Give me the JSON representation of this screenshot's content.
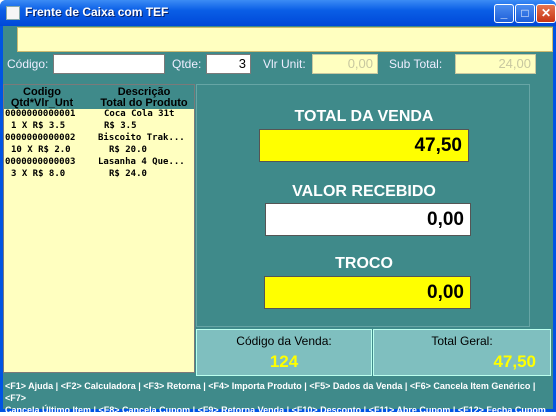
{
  "window": {
    "title": "Frente de Caixa com TEF",
    "minimize": "_",
    "maximize": "□",
    "close": "✕"
  },
  "message_bar": "",
  "inputs": {
    "codigo_label": "Código:",
    "codigo_value": "",
    "qtde_label": "Qtde:",
    "qtde_value": "3",
    "vlr_unit_label": "Vlr Unit:",
    "vlr_unit_value": "0,00",
    "sub_total_label": "Sub Total:",
    "sub_total_value": "24,00"
  },
  "list": {
    "header": {
      "col1_line1": "Codigo",
      "col1_line2": "Qtd*Vlr_Unt",
      "col2_line1": "Descrição",
      "col2_line2": "Total do Produto"
    },
    "items": [
      {
        "codigo": "0000000000001",
        "descricao": "Coca Cola 31t",
        "qtd_vlr": "1 X R$ 3.5",
        "total": "R$ 3.5"
      },
      {
        "codigo": "0000000000002",
        "descricao": "Biscoito Trak...",
        "qtd_vlr": "10 X R$ 2.0",
        "total": "R$ 20.0"
      },
      {
        "codigo": "0000000000003",
        "descricao": "Lasanha 4 Que...",
        "qtd_vlr": "3 X R$ 8.0",
        "total": "R$ 24.0"
      }
    ]
  },
  "totals": {
    "total_venda_label": "TOTAL DA VENDA",
    "total_venda_value": "47,50",
    "valor_recebido_label": "VALOR RECEBIDO",
    "valor_recebido_value": "0,00",
    "troco_label": "TROCO",
    "troco_value": "0,00"
  },
  "status": {
    "codigo_venda_label": "Código da Venda:",
    "codigo_venda_value": "124",
    "total_geral_label": "Total Geral:",
    "total_geral_value": "47,50"
  },
  "footer": {
    "shortcuts_line1": "<F1> Ajuda | <F2> Calculadora | <F3> Retorna | <F4> Importa Produto | <F5> Dados da Venda | <F6> Cancela Item Genérico | <F7>",
    "shortcuts_line2": "Cancela Último Item | <F8> Cancela Cupom | <F9> Retorna Venda | <F10> Desconto | <F11> Abre Cupom | <F12> Fecha Cupom"
  },
  "colors": {
    "background": "#3f8a8a",
    "field_yellow": "#ffff00",
    "panel_cream": "#ffffc0",
    "status_value": "#ffff00"
  }
}
